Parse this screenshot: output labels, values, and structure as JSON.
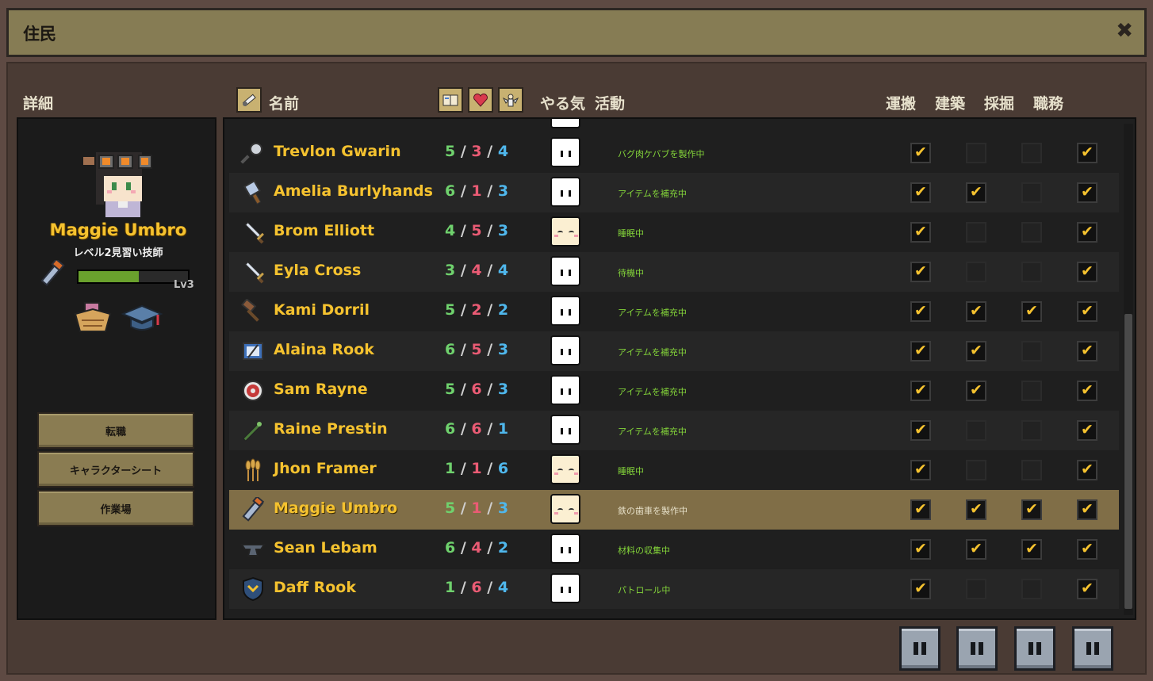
{
  "window": {
    "title": "住民",
    "close_icon": "close-icon"
  },
  "headers": {
    "details": "詳細",
    "name": "名前",
    "motivation": "やる気",
    "activity": "活動",
    "haul": "運搬",
    "build": "建築",
    "mine": "採掘",
    "job": "職務"
  },
  "header_icons": [
    "sort-profession-icon",
    "book-icon",
    "heart-icon",
    "angel-icon"
  ],
  "selected": {
    "name": "Maggie Umbro",
    "title": "レベル2見習い技師",
    "level": "Lv3",
    "xp_fraction": 0.55,
    "profession_icon": "wrench-icon",
    "trait_icons": [
      "basket-icon",
      "graduation-cap-icon"
    ]
  },
  "actions": {
    "change_job": "転職",
    "character_sheet": "キャラクターシート",
    "workshop": "作業場"
  },
  "residents": [
    {
      "name": "Trevlon Gwarin",
      "icon": "frying-pan-icon",
      "s1": "5",
      "s2": "3",
      "s3": "4",
      "mood": "awake",
      "activity": "バグ肉ケバブを製作中",
      "haul": true,
      "build": false,
      "mine": false,
      "job": true
    },
    {
      "name": "Amelia Burlyhands",
      "icon": "cleaver-icon",
      "s1": "6",
      "s2": "1",
      "s3": "3",
      "mood": "awake",
      "activity": "アイテムを補充中",
      "haul": true,
      "build": true,
      "mine": false,
      "job": true
    },
    {
      "name": "Brom Elliott",
      "icon": "sword-icon",
      "s1": "4",
      "s2": "5",
      "s3": "3",
      "mood": "sleep",
      "activity": "睡眠中",
      "haul": true,
      "build": false,
      "mine": false,
      "job": true
    },
    {
      "name": "Eyla Cross",
      "icon": "sword-icon",
      "s1": "3",
      "s2": "4",
      "s3": "4",
      "mood": "awake",
      "activity": "待機中",
      "haul": true,
      "build": false,
      "mine": false,
      "job": true
    },
    {
      "name": "Kami Dorril",
      "icon": "hammer-icon",
      "s1": "5",
      "s2": "2",
      "s3": "2",
      "mood": "awake",
      "activity": "アイテムを補充中",
      "haul": true,
      "build": true,
      "mine": true,
      "job": true
    },
    {
      "name": "Alaina Rook",
      "icon": "loom-icon",
      "s1": "6",
      "s2": "5",
      "s3": "3",
      "mood": "awake",
      "activity": "アイテムを補充中",
      "haul": true,
      "build": true,
      "mine": false,
      "job": true
    },
    {
      "name": "Sam Rayne",
      "icon": "target-icon",
      "s1": "5",
      "s2": "6",
      "s3": "3",
      "mood": "awake",
      "activity": "アイテムを補充中",
      "haul": true,
      "build": true,
      "mine": false,
      "job": true
    },
    {
      "name": "Raine Prestin",
      "icon": "staff-icon",
      "s1": "6",
      "s2": "6",
      "s3": "1",
      "mood": "awake",
      "activity": "アイテムを補充中",
      "haul": true,
      "build": false,
      "mine": false,
      "job": true
    },
    {
      "name": "Jhon Framer",
      "icon": "wheat-icon",
      "s1": "1",
      "s2": "1",
      "s3": "6",
      "mood": "sleep",
      "activity": "睡眠中",
      "haul": true,
      "build": false,
      "mine": false,
      "job": true
    },
    {
      "name": "Maggie Umbro",
      "icon": "wrench-icon",
      "s1": "5",
      "s2": "1",
      "s3": "3",
      "mood": "sleep",
      "activity": "鉄の歯車を製作中",
      "haul": true,
      "build": true,
      "mine": true,
      "job": true,
      "selected": true
    },
    {
      "name": "Sean Lebam",
      "icon": "anvil-icon",
      "s1": "6",
      "s2": "4",
      "s3": "2",
      "mood": "awake",
      "activity": "材料の収集中",
      "haul": true,
      "build": true,
      "mine": true,
      "job": true
    },
    {
      "name": "Daff Rook",
      "icon": "shield-badge-icon",
      "s1": "1",
      "s2": "6",
      "s3": "4",
      "mood": "awake",
      "activity": "パトロール中",
      "haul": true,
      "build": false,
      "mine": false,
      "job": true
    }
  ],
  "bottom_controls": [
    "pause-icon",
    "pause-icon",
    "pause-icon",
    "pause-icon"
  ],
  "colors": {
    "accent_gold": "#f5c22f",
    "stat_green": "#6fd16d",
    "stat_red": "#ea5b74",
    "stat_blue": "#4fb7ec",
    "activity_green": "#84d53a"
  }
}
